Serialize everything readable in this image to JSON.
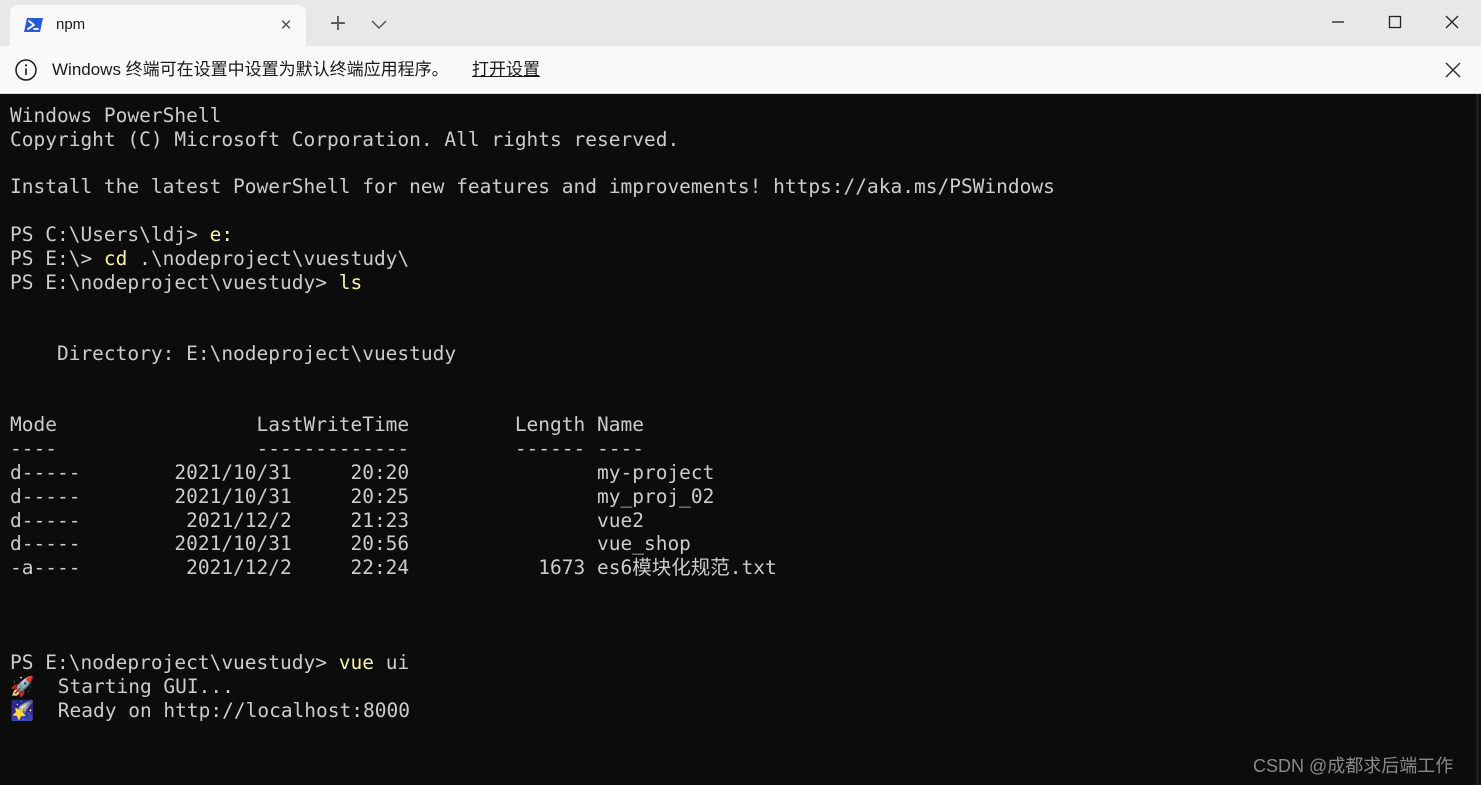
{
  "titlebar": {
    "tab_title": "npm",
    "tab_icon": "powershell-icon",
    "tab_close_label": "✕",
    "new_tab_label": "+",
    "dropdown_icon": "chevron-down-icon",
    "minimize_icon": "minimize-icon",
    "maximize_icon": "maximize-icon",
    "close_icon": "close-icon"
  },
  "infobar": {
    "icon": "info-icon",
    "message": "Windows 终端可在设置中设置为默认终端应用程序。",
    "link_text": "打开设置",
    "dismiss_icon": "close-icon"
  },
  "terminal": {
    "lines": [
      {
        "text": "Windows PowerShell"
      },
      {
        "text": "Copyright (C) Microsoft Corporation. All rights reserved."
      },
      {
        "text": ""
      },
      {
        "text": "Install the latest PowerShell for new features and improvements! https://aka.ms/PSWindows"
      },
      {
        "text": ""
      },
      {
        "prompt": "PS C:\\Users\\ldj> ",
        "cmd": "e:",
        "args": ""
      },
      {
        "prompt": "PS E:\\> ",
        "cmd": "cd",
        "args": " .\\nodeproject\\vuestudy\\"
      },
      {
        "prompt": "PS E:\\nodeproject\\vuestudy> ",
        "cmd": "ls",
        "args": ""
      },
      {
        "text": ""
      },
      {
        "text": ""
      },
      {
        "text": "    Directory: E:\\nodeproject\\vuestudy"
      },
      {
        "text": ""
      },
      {
        "text": ""
      },
      {
        "text": "Mode                 LastWriteTime         Length Name"
      },
      {
        "text": "----                 -------------         ------ ----"
      },
      {
        "text": "d-----        2021/10/31     20:20                my-project"
      },
      {
        "text": "d-----        2021/10/31     20:25                my_proj_02"
      },
      {
        "text": "d-----         2021/12/2     21:23                vue2"
      },
      {
        "text": "d-----        2021/10/31     20:56                vue_shop"
      },
      {
        "text": "-a----         2021/12/2     22:24           1673 es6模块化规范.txt"
      },
      {
        "text": ""
      },
      {
        "text": ""
      },
      {
        "text": ""
      },
      {
        "prompt": "PS E:\\nodeproject\\vuestudy> ",
        "cmd": "vue",
        "args": " ui"
      },
      {
        "text": "🚀  Starting GUI..."
      },
      {
        "text": "🌠  Ready on http://localhost:8000"
      }
    ]
  },
  "watermark": "CSDN @成都求后端工作",
  "colors": {
    "terminal_bg": "#0c0c0c",
    "terminal_fg": "#cccccc",
    "command_fg": "#f9f1a5",
    "titlebar_bg": "#e8e8e8",
    "tab_bg": "#f9f9f9",
    "powershell_blue": "#2a5bd7"
  }
}
